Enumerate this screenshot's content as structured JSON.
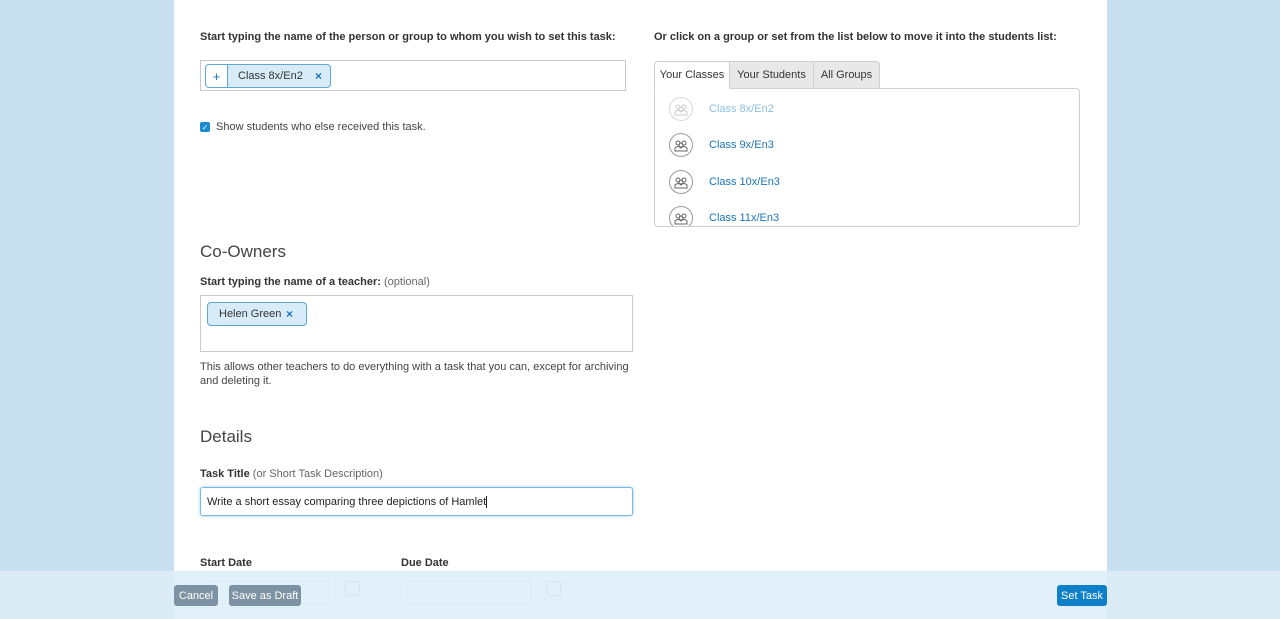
{
  "recipients": {
    "prompt": "Start typing the name of the person or group to whom you wish to set this task:",
    "tokens": [
      {
        "label": "Class 8x/En2",
        "remove": "×",
        "add": "+"
      }
    ],
    "show_students_checkbox": {
      "checked": true,
      "label": "Show students who else received this task."
    }
  },
  "group_picker": {
    "prompt": "Or click on a group or set from the list below to move it into the students list:",
    "tabs": [
      {
        "label": "Your Classes",
        "active": true
      },
      {
        "label": "Your Students",
        "active": false
      },
      {
        "label": "All Groups",
        "active": false
      }
    ],
    "classes": [
      {
        "name": "Class 8x/En2",
        "disabled": true
      },
      {
        "name": "Class 9x/En3",
        "disabled": false
      },
      {
        "name": "Class 10x/En3",
        "disabled": false
      },
      {
        "name": "Class 11x/En3",
        "disabled": false
      }
    ]
  },
  "co_owners": {
    "heading": "Co-Owners",
    "prompt": "Start typing the name of a teacher:",
    "optional": "(optional)",
    "tokens": [
      {
        "label": "Helen Green",
        "remove": "×"
      }
    ],
    "help": "This allows other teachers to do everything with a task that you can, except for archiving and deleting it."
  },
  "details": {
    "heading": "Details",
    "title_label": "Task Title",
    "title_hint": "(or Short Task Description)",
    "title_value": "Write a short essay comparing three depictions of Hamlet",
    "start_date_label": "Start Date",
    "due_date_label": "Due Date"
  },
  "footer": {
    "cancel": "Cancel",
    "save_draft": "Save as Draft",
    "set_task": "Set Task"
  },
  "colors": {
    "background": "#c7dfee",
    "accent": "#0e7fc9",
    "link": "#1b75bb"
  }
}
